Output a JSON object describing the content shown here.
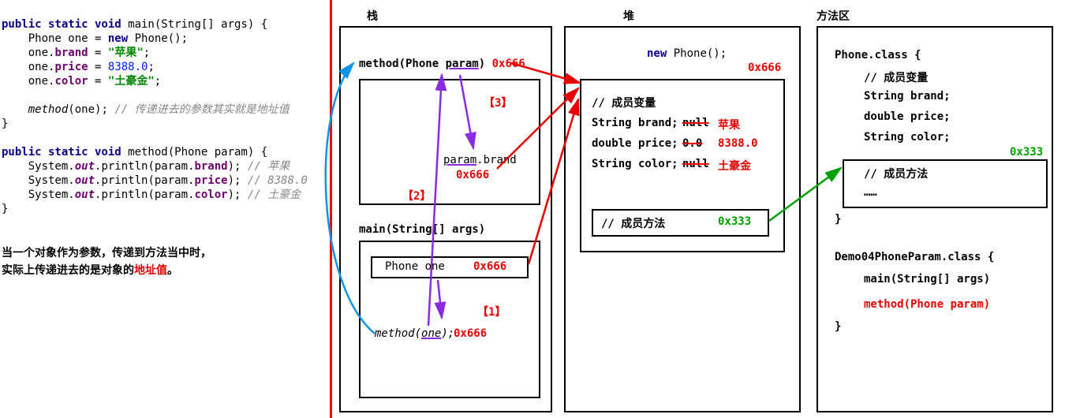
{
  "code": {
    "main_sig_pre": "public static void",
    "main_sig_post": " main(String[] args) {",
    "l1a": "    Phone one = ",
    "l1b_new": "new",
    "l1c": " Phone();",
    "l2a": "    one.",
    "l2b": "brand",
    "l2c": " = ",
    "l2d": "\"苹果\"",
    "l2e": ";",
    "l3a": "    one.",
    "l3b": "price",
    "l3c": " = ",
    "l3d": "8388.0",
    "l3e": ";",
    "l4a": "    one.",
    "l4b": "color",
    "l4c": " = ",
    "l4d": "\"土豪金\"",
    "l4e": ";",
    "l_blank": "",
    "l5a": "    method",
    "l5b": "(one); ",
    "l5c": "// 传递进去的参数其实就是地址值",
    "l6": "}",
    "method_sig_pre": "public static void",
    "method_sig_post": " method(Phone param) {",
    "m1a": "    System.",
    "m1b": "out",
    "m1c": ".println(param.",
    "m1d": "brand",
    "m1e": "); ",
    "m1f": "// 苹果",
    "m2a": "    System.",
    "m2b": "out",
    "m2c": ".println(param.",
    "m2d": "price",
    "m2e": "); ",
    "m2f": "// 8388.0",
    "m3a": "    System.",
    "m3b": "out",
    "m3c": ".println(param.",
    "m3d": "color",
    "m3e": "); ",
    "m3f": "// 土豪金",
    "mend": "}"
  },
  "conclusion": {
    "line1": "当一个对象作为参数，传递到方法当中时，",
    "line2a": "实际上传递进去的是对象的",
    "line2b": "地址值",
    "line2c": "。"
  },
  "areas": {
    "stack": "栈",
    "heap": "堆",
    "method": "方法区"
  },
  "stack": {
    "frame1": {
      "header_a": "method(Phone ",
      "header_b": "param",
      "header_c": ") ",
      "header_addr": "0x666",
      "inner_a": "param",
      "inner_b": ".brand",
      "inner_addr": "0x666"
    },
    "frame2": {
      "header": "main(String[] args)",
      "var_name": "Phone  one",
      "var_addr": "0x666",
      "call_a": "method",
      "call_b": "(",
      "call_c": "one",
      "call_d": ");",
      "call_addr": "0x666"
    },
    "tags": {
      "t1": "【1】",
      "t2": "【2】",
      "t3": "【3】"
    }
  },
  "heap": {
    "new_expr_a": "new",
    "new_expr_b": " Phone();",
    "new_addr": "0x666",
    "comment_mv": "// 成员变量",
    "f1a": "String brand;",
    "f1b_old": "null",
    "f1c_new": "苹果",
    "f2a": "double price;",
    "f2b_old": "0.0",
    "f2c_new": "8388.0",
    "f3a": "String color;",
    "f3b_old": "null",
    "f3c_new": "土豪金",
    "comment_mm": "// 成员方法",
    "mm_addr": "0x333"
  },
  "methodarea": {
    "cls_open": "Phone.class {",
    "cmt_v": "// 成员变量",
    "v1": "String brand;",
    "v2": "double price;",
    "v3": "String color;",
    "addr": "0x333",
    "cmt_m": "// 成员方法",
    "dots": "……",
    "cls_close": "}",
    "demo_open": "Demo04PhoneParam.class {",
    "demo_main": "main(String[] args)",
    "demo_method": "method(Phone param)",
    "demo_close": "}"
  }
}
